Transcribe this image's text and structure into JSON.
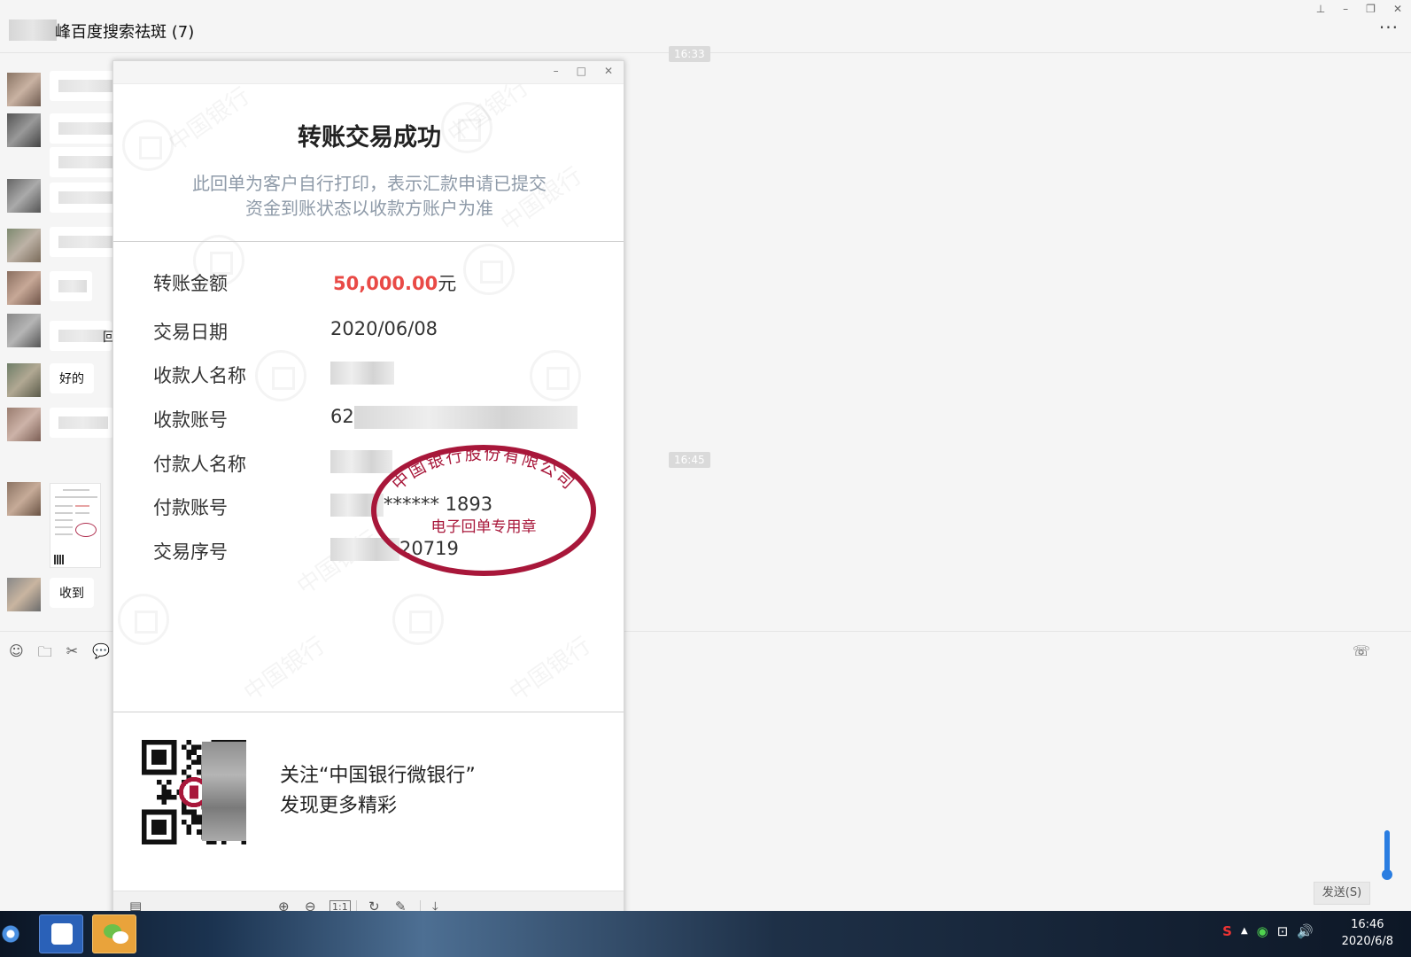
{
  "chat": {
    "title": "峰百度搜索祛斑 (7)",
    "more": "···",
    "times": [
      "16:33",
      "16:45"
    ],
    "bubbles": {
      "ok": "好的",
      "received": "收到",
      "frag": "回"
    }
  },
  "window_controls": {
    "pin": "⊥",
    "minimize": "–",
    "restore": "❐",
    "close": "✕"
  },
  "input_area": {
    "tools": [
      "☺",
      "🗀",
      "✂",
      "💬"
    ],
    "call_icon": "☏",
    "send_label": "发送(S)"
  },
  "viewer": {
    "controls": {
      "minimize": "–",
      "maximize": "□",
      "close": "✕"
    },
    "toolbar": {
      "thumbnail": "▤",
      "zoom_in": "⊕",
      "zoom_out": "⊖",
      "actual_size": "1:1",
      "rotate": "↻",
      "edit": "✎",
      "download": "⤓"
    }
  },
  "receipt": {
    "title": "转账交易成功",
    "notice_line1": "此回单为客户自行打印，表示汇款申请已提交",
    "notice_line2": "资金到账状态以收款方账户为准",
    "watermark_text": "中国银行",
    "rows": [
      {
        "label": "转账金额",
        "amount": "50,000.00",
        "unit": "元"
      },
      {
        "label": "交易日期",
        "value": "2020/06/08"
      },
      {
        "label": "收款人名称",
        "value": ""
      },
      {
        "label": "收款账号",
        "prefix": "62"
      },
      {
        "label": "付款人名称",
        "value": ""
      },
      {
        "label": "付款账号",
        "suffix": "****** 1893"
      },
      {
        "label": "交易序号",
        "suffix": "20719"
      }
    ],
    "seal": {
      "top_text": "中国银行股份有限公司",
      "bottom_text": "电子回单专用章",
      "color": "#a8173a"
    },
    "footer_line1": "关注“中国银行微银行”",
    "footer_line2": "发现更多精彩"
  },
  "taskbar": {
    "tray": [
      "S",
      "▲",
      "◉",
      "⊡",
      "🔊"
    ],
    "time": "16:46",
    "date": "2020/6/8"
  }
}
